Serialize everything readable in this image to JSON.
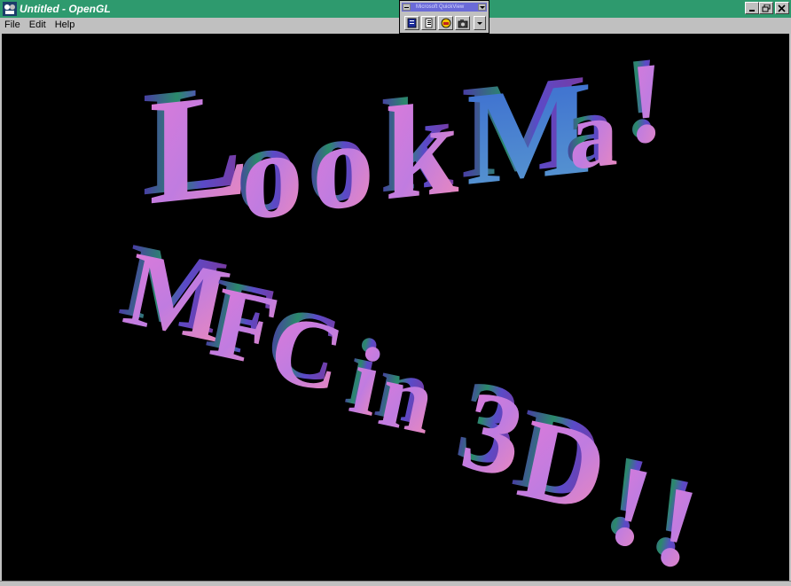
{
  "window": {
    "title": "Untitled - OpenGL"
  },
  "menu": {
    "items": [
      {
        "label": "File"
      },
      {
        "label": "Edit"
      },
      {
        "label": "Help"
      }
    ]
  },
  "floating_toolbar": {
    "title": "Microsoft QuickView"
  },
  "scene": {
    "line1": [
      "L",
      "o",
      "o",
      "k",
      "M",
      "a",
      "!"
    ],
    "line2": [
      "M",
      "F",
      "C",
      "i",
      "n",
      "3",
      "D",
      "!",
      "!"
    ],
    "background_color": "#000000",
    "title_bar_color": "#2e9a6e"
  }
}
